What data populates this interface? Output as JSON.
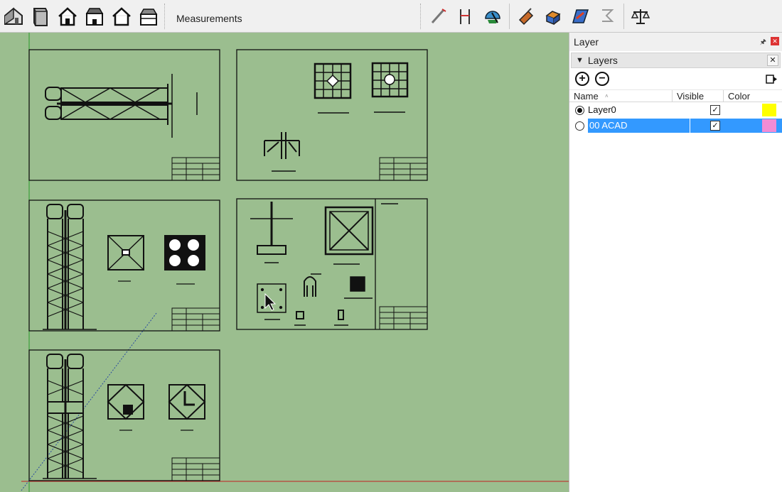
{
  "toolbar": {
    "measurements_label": "Measurements",
    "left_icons": [
      "iso-house-icon",
      "door-icon",
      "front-view-icon",
      "top-view-icon",
      "side-view-icon",
      "back-view-icon"
    ],
    "right_icons": [
      "tape-measure-icon",
      "dimension-icon",
      "protractor-icon",
      "paint-bucket-icon",
      "push-pull-icon",
      "follow-me-icon",
      "offset-icon",
      "scale-icon"
    ]
  },
  "panel": {
    "title": "Layer",
    "section_title": "Layers",
    "columns": {
      "name": "Name",
      "visible": "Visible",
      "color": "Color"
    },
    "layers": [
      {
        "name": "Layer0",
        "active": true,
        "visible": true,
        "color": "#ffff00",
        "selected": false
      },
      {
        "name": "00 ACAD",
        "active": false,
        "visible": true,
        "color": "#f28cd5",
        "selected": true
      }
    ]
  },
  "colors": {
    "canvas_bg": "#9bbe8f",
    "selection": "#3399ff"
  }
}
